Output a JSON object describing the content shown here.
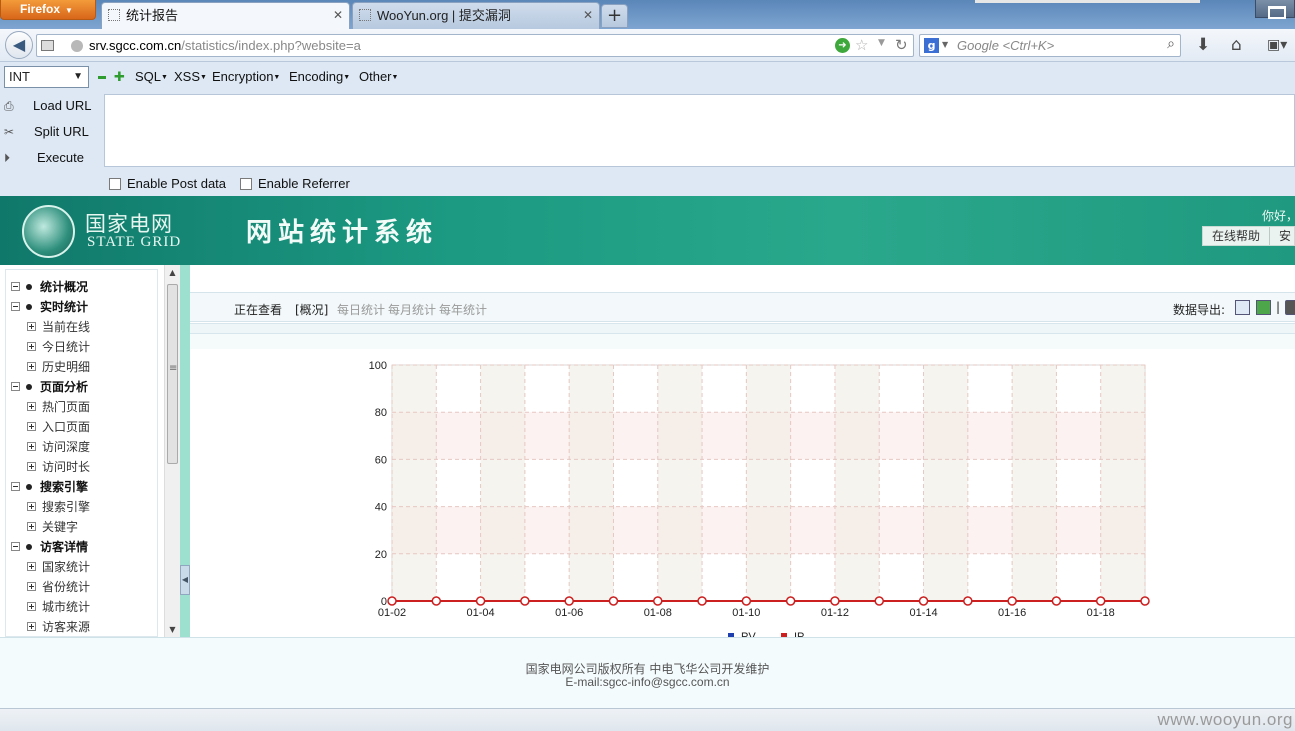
{
  "browser": {
    "menu_button": "Firefox",
    "tabs": [
      {
        "title": "统计报告",
        "active": true
      },
      {
        "title": "WooYun.org | 提交漏洞",
        "active": false
      }
    ],
    "new_tab": "+",
    "url": {
      "host": "srv.sgcc.com.cn",
      "path": "/statistics/index.php?website=a"
    },
    "search_placeholder": "Google <Ctrl+K>"
  },
  "hackbar": {
    "type_select": "INT",
    "menus": [
      "SQL",
      "XSS",
      "Encryption",
      "Encoding",
      "Other"
    ],
    "actions": [
      "Load URL",
      "Split URL",
      "Execute"
    ],
    "textarea_value": "",
    "options": [
      "Enable Post data",
      "Enable Referrer"
    ]
  },
  "site": {
    "logo_cn": "国家电网",
    "logo_en": "STATE GRID",
    "title": "网站统计系统",
    "greeting": "你好，",
    "header_links": [
      "在线帮助",
      "安"
    ]
  },
  "menu": [
    {
      "label": "统计概况",
      "items": []
    },
    {
      "label": "实时统计",
      "items": [
        "当前在线",
        "今日统计",
        "历史明细"
      ]
    },
    {
      "label": "页面分析",
      "items": [
        "热门页面",
        "入口页面",
        "访问深度",
        "访问时长"
      ]
    },
    {
      "label": "搜索引擎",
      "items": [
        "搜索引擎",
        "关键字"
      ]
    },
    {
      "label": "访客详情",
      "items": [
        "国家统计",
        "省份统计",
        "城市统计",
        "访客来源"
      ]
    }
  ],
  "viewbar": {
    "label": "正在查看",
    "tabs": [
      "[概况]",
      "每日统计",
      "每月统计",
      "每年统计"
    ],
    "export_label": "数据导出:",
    "separator": "|"
  },
  "chart_data": {
    "type": "line",
    "x": [
      "01-02",
      "01-03",
      "01-04",
      "01-05",
      "01-06",
      "01-07",
      "01-08",
      "01-09",
      "01-10",
      "01-11",
      "01-12",
      "01-13",
      "01-14",
      "01-15",
      "01-16",
      "01-17",
      "01-18",
      "01-19"
    ],
    "x_tick_labels": [
      "01-02",
      "01-04",
      "01-06",
      "01-08",
      "01-10",
      "01-12",
      "01-14",
      "01-16",
      "01-18"
    ],
    "ylim": [
      0,
      100
    ],
    "y_ticks": [
      0,
      20,
      40,
      60,
      80,
      100
    ],
    "grid": true,
    "legend_position": "bottom",
    "series": [
      {
        "name": "PV",
        "color": "#1f3fae",
        "values": [
          0,
          0,
          0,
          0,
          0,
          0,
          0,
          0,
          0,
          0,
          0,
          0,
          0,
          0,
          0,
          0,
          0,
          0
        ]
      },
      {
        "name": "IP",
        "color": "#cc1f1f",
        "values": [
          0,
          0,
          0,
          0,
          0,
          0,
          0,
          0,
          0,
          0,
          0,
          0,
          0,
          0,
          0,
          0,
          0,
          0
        ]
      }
    ]
  },
  "footer": {
    "copyright": "国家电网公司版权所有 中电飞华公司开发维护",
    "email": "E-mail:sgcc-info@sgcc.com.cn"
  },
  "watermark": "www.wooyun.org"
}
